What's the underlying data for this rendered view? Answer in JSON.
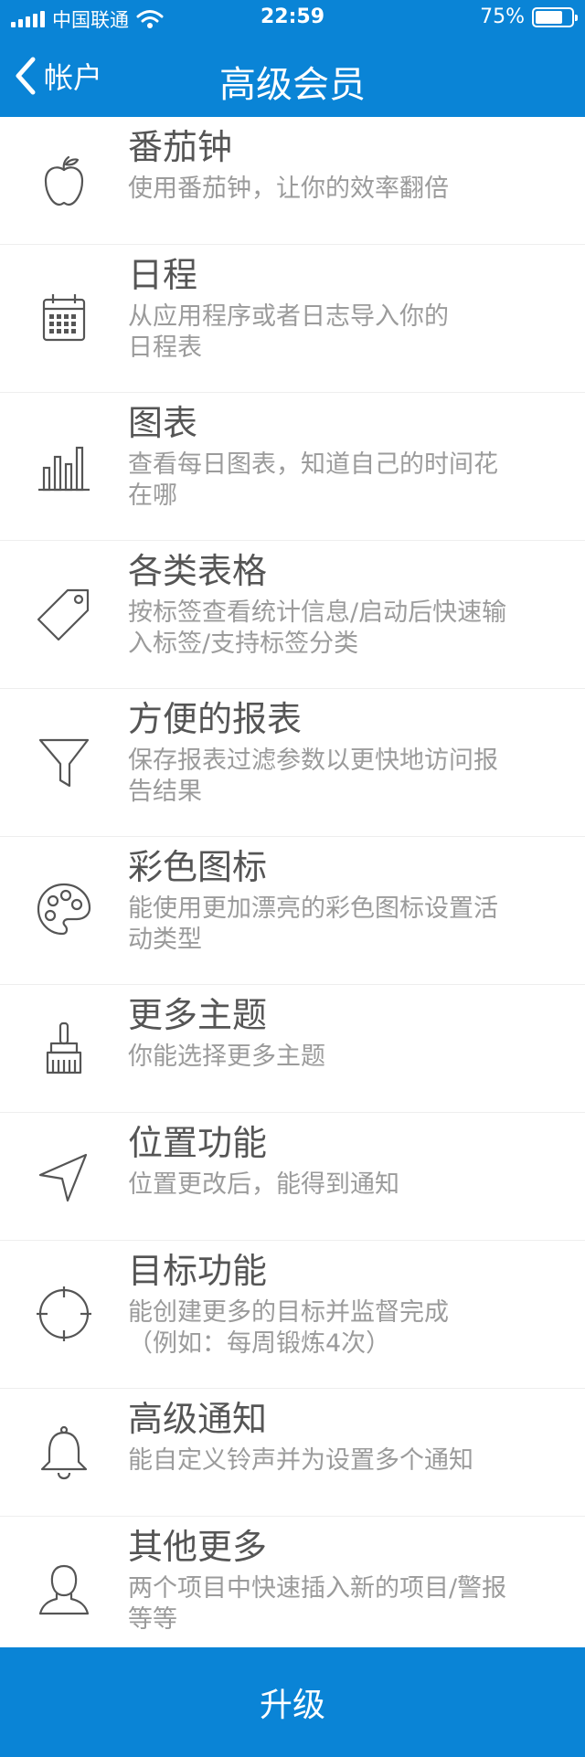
{
  "status_bar": {
    "carrier": "中国联通",
    "time": "22:59",
    "battery": "75%",
    "battery_level": 0.75
  },
  "nav": {
    "back_label": "帐户",
    "title": "高级会员"
  },
  "features": [
    {
      "icon": "apple-icon",
      "title": "番茄钟",
      "desc": "使用番茄钟，让你的效率翻倍"
    },
    {
      "icon": "calendar-icon",
      "title": "日程",
      "desc": "从应用程序或者日志导入你的\n日程表"
    },
    {
      "icon": "bar-chart-icon",
      "title": "图表",
      "desc": "查看每日图表，知道自己的时间花\n在哪"
    },
    {
      "icon": "tag-icon",
      "title": "各类表格",
      "desc": "按标签查看统计信息/启动后快速输\n入标签/支持标签分类"
    },
    {
      "icon": "filter-icon",
      "title": "方便的报表",
      "desc": "保存报表过滤参数以更快地访问报\n告结果"
    },
    {
      "icon": "palette-icon",
      "title": "彩色图标",
      "desc": "能使用更加漂亮的彩色图标设置活\n动类型"
    },
    {
      "icon": "brush-icon",
      "title": "更多主题",
      "desc": "你能选择更多主题"
    },
    {
      "icon": "location-arrow-icon",
      "title": "位置功能",
      "desc": "位置更改后，能得到通知"
    },
    {
      "icon": "target-icon",
      "title": "目标功能",
      "desc": "能创建更多的目标并监督完成\n（例如：每周锻炼4次）"
    },
    {
      "icon": "bell-icon",
      "title": "高级通知",
      "desc": "能自定义铃声并为设置多个通知"
    },
    {
      "icon": "person-icon",
      "title": "其他更多",
      "desc": "两个项目中快速插入新的项目/警报\n等等"
    }
  ],
  "upgrade_label": "升级",
  "colors": {
    "accent": "#0a84d6",
    "title_text": "#555555",
    "desc_text": "#9b9b9b"
  }
}
